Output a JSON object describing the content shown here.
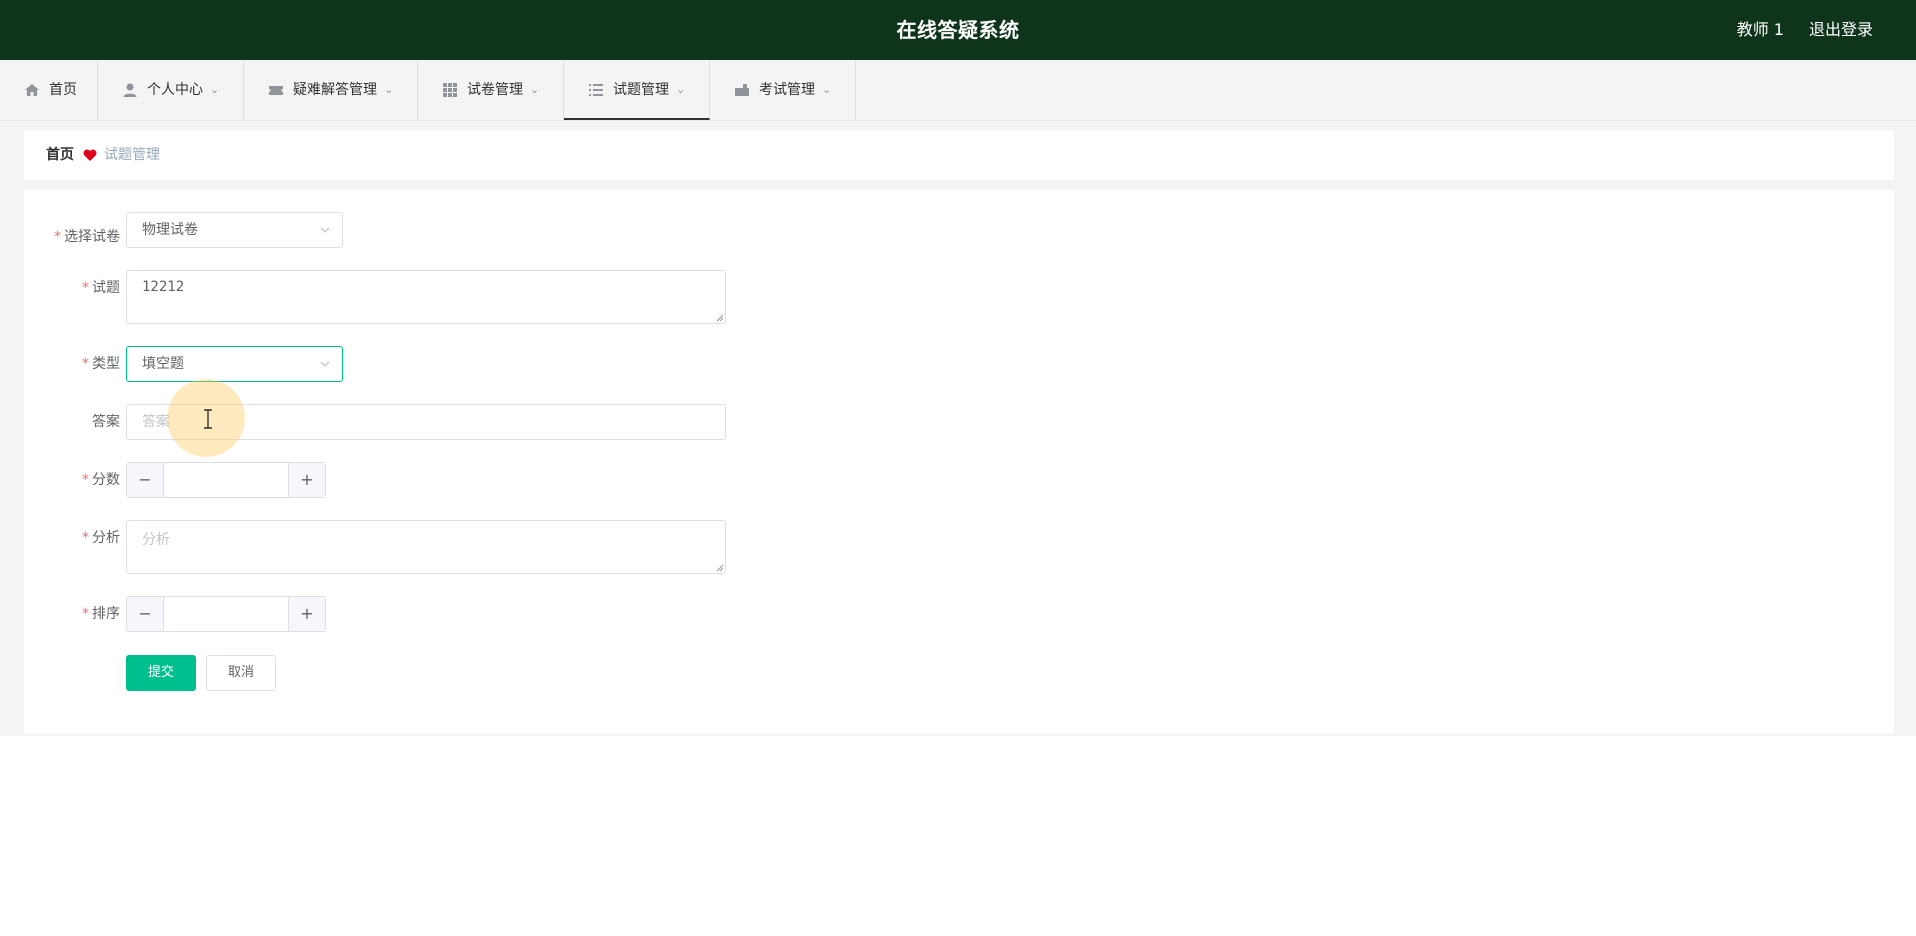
{
  "header": {
    "title": "在线答疑系统",
    "user": "教师 1",
    "logout": "退出登录"
  },
  "nav": {
    "items": [
      {
        "label": "首页",
        "icon": "home-icon"
      },
      {
        "label": "个人中心",
        "icon": "user-icon"
      },
      {
        "label": "疑难解答管理",
        "icon": "ticket-icon"
      },
      {
        "label": "试卷管理",
        "icon": "grid-icon"
      },
      {
        "label": "试题管理",
        "icon": "list-icon"
      },
      {
        "label": "考试管理",
        "icon": "briefcase-icon"
      }
    ],
    "active": "试题管理"
  },
  "breadcrumb": {
    "home": "首页",
    "current": "试题管理",
    "separator_icon": "heart-icon",
    "separator_color": "#e0001b"
  },
  "form": {
    "paper": {
      "label": "选择试卷",
      "value": "物理试卷",
      "required": true
    },
    "question": {
      "label": "试题",
      "value": "12212",
      "required": true
    },
    "type": {
      "label": "类型",
      "value": "填空题",
      "required": true
    },
    "answer": {
      "label": "答案",
      "placeholder": "答案",
      "required": false
    },
    "score": {
      "label": "分数",
      "value": "",
      "required": true
    },
    "analysis": {
      "label": "分析",
      "placeholder": "分析",
      "required": true
    },
    "order": {
      "label": "排序",
      "value": "",
      "required": true
    },
    "required_mark": "*",
    "submit": "提交",
    "cancel": "取消"
  },
  "colors": {
    "header_bg": "#0e351b",
    "accent": "#00bf8f",
    "required": "#f56c6c"
  }
}
